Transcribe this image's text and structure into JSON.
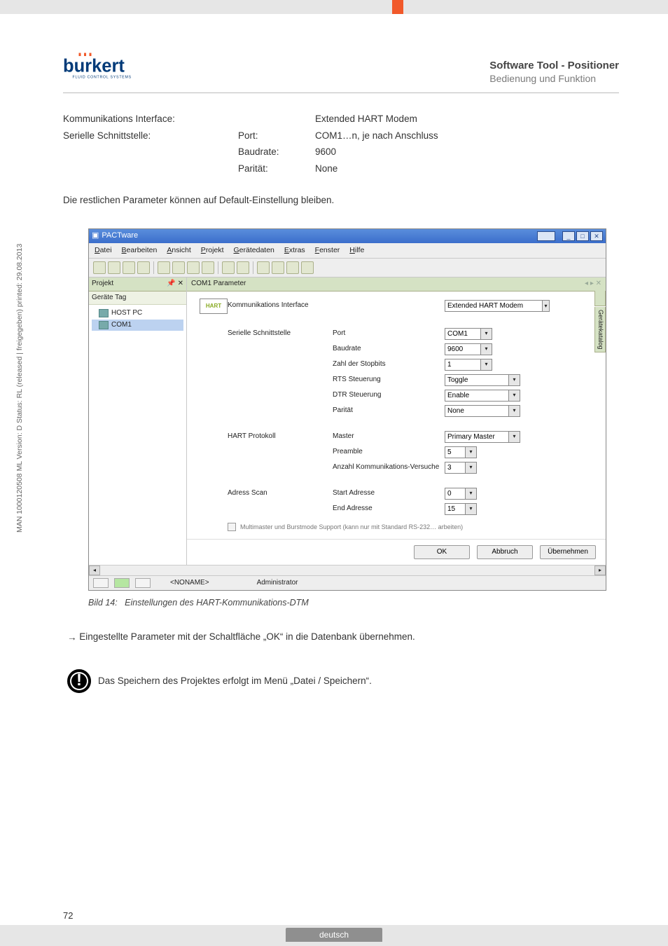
{
  "header": {
    "brand": "burkert",
    "brand_sub": "FLUID CONTROL SYSTEMS",
    "title": "Software Tool - Positioner",
    "subtitle": "Bedienung und Funktion"
  },
  "intro": {
    "row1_label": "Kommunikations Interface:",
    "row1_value": "Extended HART Modem",
    "row2_label": "Serielle Schnittstelle:",
    "port_label": "Port:",
    "port_value": "COM1…n, je nach Anschluss",
    "baud_label": "Baudrate:",
    "baud_value": "9600",
    "par_label": "Parität:",
    "par_value": "None",
    "note": "Die restlichen Parameter können auf Default-Einstellung bleiben."
  },
  "app": {
    "title": "PACTware",
    "menu": {
      "datei": "Datei",
      "bearbeiten": "Bearbeiten",
      "ansicht": "Ansicht",
      "projekt": "Projekt",
      "geraetedaten": "Gerätedaten",
      "extras": "Extras",
      "fenster": "Fenster",
      "hilfe": "Hilfe"
    },
    "tree": {
      "panel": "Projekt",
      "pin": "📌 ✕",
      "sub": "Geräte Tag",
      "item1": "HOST PC",
      "item2": "COM1"
    },
    "main": {
      "tab_title": "COM1 Parameter",
      "hart_badge": "HART",
      "vtab": "Gerätekatalog",
      "groups": {
        "g1": "Kommunikations Interface",
        "g2": "Serielle Schnittstelle",
        "g3": "HART Protokoll",
        "g4": "Adress Scan"
      },
      "fields": {
        "iface": {
          "label": "",
          "value": "Extended HART Modem"
        },
        "port": {
          "label": "Port",
          "value": "COM1"
        },
        "baud": {
          "label": "Baudrate",
          "value": "9600"
        },
        "stop": {
          "label": "Zahl der Stopbits",
          "value": "1"
        },
        "rts": {
          "label": "RTS Steuerung",
          "value": "Toggle"
        },
        "dtr": {
          "label": "DTR Steuerung",
          "value": "Enable"
        },
        "par": {
          "label": "Parität",
          "value": "None"
        },
        "master": {
          "label": "Master",
          "value": "Primary Master"
        },
        "preamble": {
          "label": "Preamble",
          "value": "5"
        },
        "retries": {
          "label": "Anzahl Kommunikations-Versuche",
          "value": "3"
        },
        "start": {
          "label": "Start Adresse",
          "value": "0"
        },
        "end": {
          "label": "End Adresse",
          "value": "15"
        }
      },
      "checkbox": "Multimaster und Burstmode Support (kann nur mit Standard RS-232… arbeiten)",
      "buttons": {
        "ok": "OK",
        "abbruch": "Abbruch",
        "uebernehmen": "Übernehmen"
      }
    },
    "status": {
      "noname": "<NONAME>",
      "role": "Administrator"
    }
  },
  "caption": {
    "prefix": "Bild 14:",
    "text": "Einstellungen des HART-Kommunikations-DTM"
  },
  "step": {
    "arrow": "→",
    "text": "Eingestellte Parameter mit der Schaltfläche „OK“ in die Datenbank übernehmen."
  },
  "note": {
    "icon": "!",
    "text": "Das Speichern des Projektes erfolgt im Menü „Datei / Speichern“."
  },
  "side": "MAN 1000120508 ML Version: D Status: RL (released | freigegeben) printed: 29.08.2013",
  "page": "72",
  "footer_lang": "deutsch"
}
